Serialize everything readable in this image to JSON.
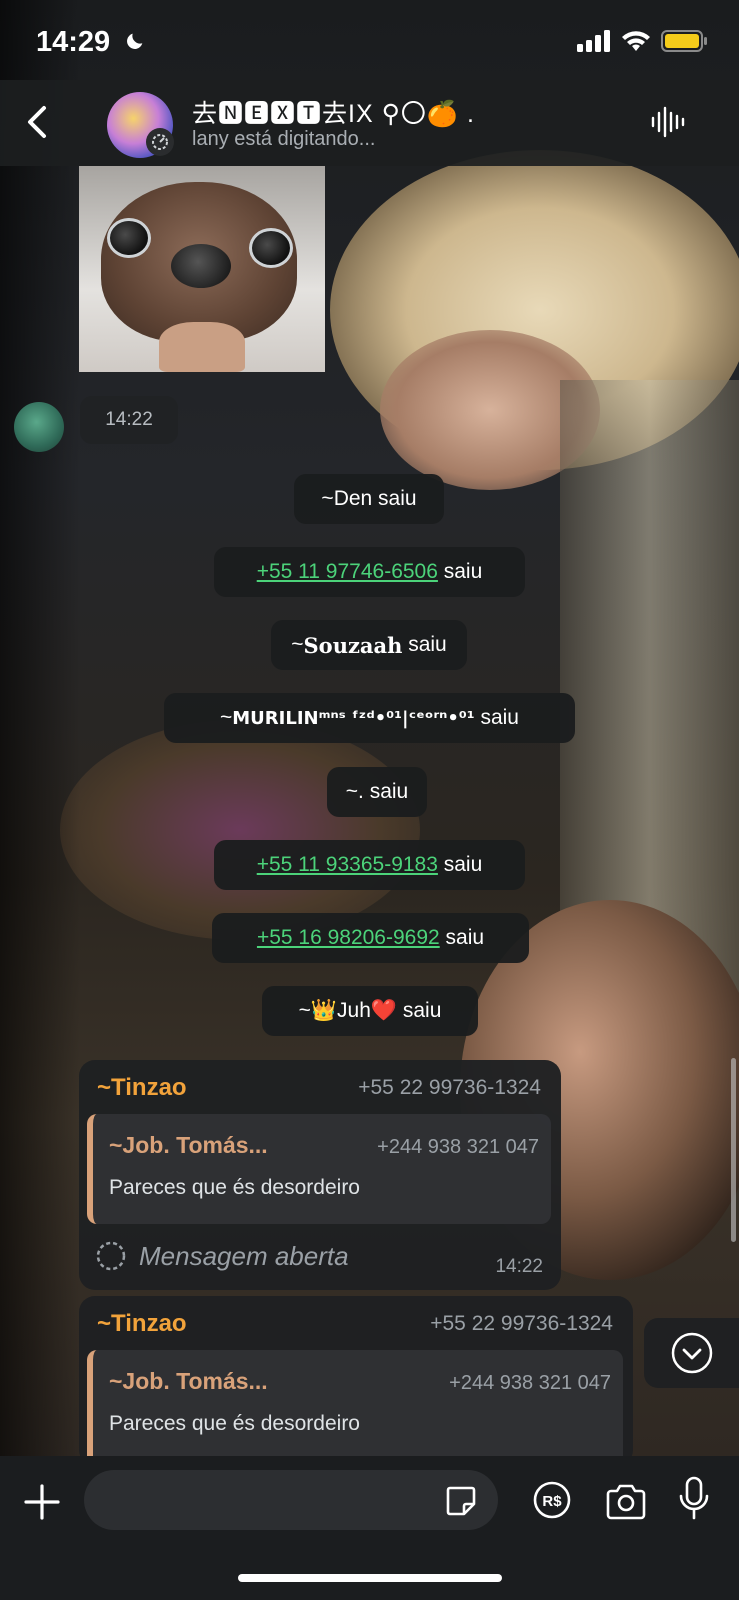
{
  "status_bar": {
    "time": "14:29"
  },
  "header": {
    "group_name": "去🅽🅴🆇🆃去IX ⚲〇🍊 .",
    "subtitle": "lany está digitando..."
  },
  "sticker_time": "14:22",
  "system_messages": [
    {
      "prefix": "~",
      "name": "Den",
      "suffix": " saiu"
    },
    {
      "prefix": "",
      "phone": "+55 11 97746-6506",
      "suffix": " saiu"
    },
    {
      "prefix": "~",
      "name": "Souzaah",
      "suffix": " saiu"
    },
    {
      "prefix": "~",
      "name": "MURILINᵐⁿˢ ᶠᶻᵈ•⁰¹|ᶜᵉᵒʳⁿ•⁰¹",
      "suffix": " saiu"
    },
    {
      "prefix": "~",
      "name": ".",
      "suffix": " saiu"
    },
    {
      "prefix": "",
      "phone": "+55 11 93365-9183",
      "suffix": " saiu"
    },
    {
      "prefix": "",
      "phone": "+55 16 98206-9692",
      "suffix": " saiu"
    },
    {
      "prefix": "~",
      "name": "👑Juh❤️",
      "suffix": " saiu"
    }
  ],
  "messages": [
    {
      "sender": "~Tinzao",
      "sender_number": "+55 22 99736-1324",
      "quote_name": "~Job. Tomás...",
      "quote_number": "+244 938 321 047",
      "quote_text": "Pareces que és desordeiro",
      "body": "Mensagem aberta",
      "time": "14:22"
    },
    {
      "sender": "~Tinzao",
      "sender_number": "+55 22 99736-1324",
      "quote_name": "~Job. Tomás...",
      "quote_number": "+244 938 321 047",
      "quote_text": "Pareces que és desordeiro"
    }
  ],
  "composer": {
    "placeholder": ""
  },
  "colors": {
    "accent_orange": "#f2a33b",
    "quote_bar": "#d9a27a",
    "phone_link": "#4cd37a"
  }
}
